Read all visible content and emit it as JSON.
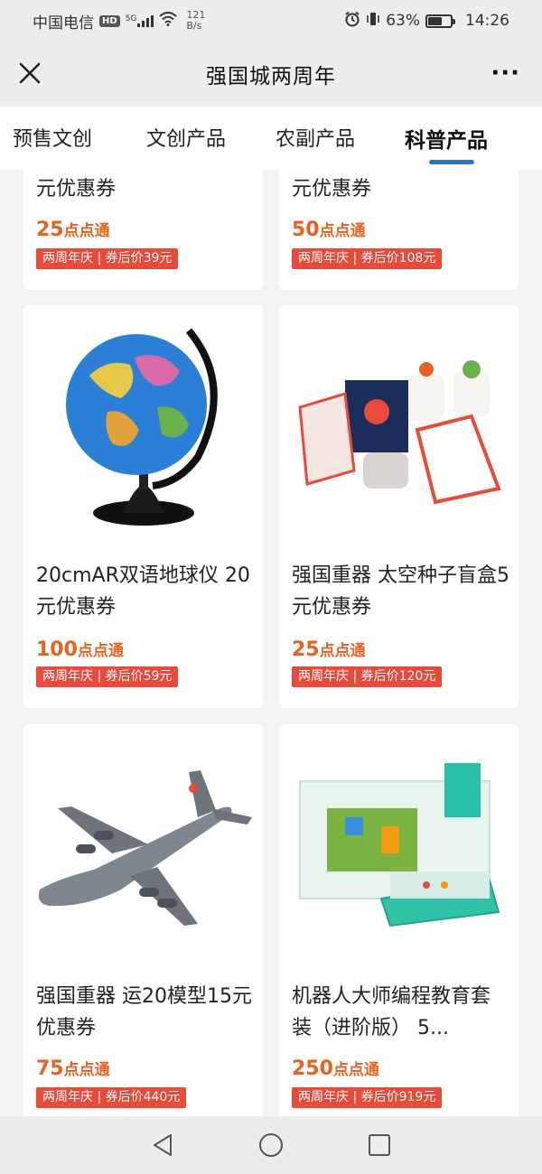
{
  "status": {
    "carrier": "中国电信",
    "hd": "HD",
    "net_type": "5G",
    "net_speed_value": "121",
    "net_speed_unit": "B/s",
    "battery": "63%",
    "battery_level": 0.63,
    "time": "14:26"
  },
  "nav": {
    "title": "强国城两周年",
    "more": "···"
  },
  "tabs": [
    {
      "label": "预售文创"
    },
    {
      "label": "文创产品"
    },
    {
      "label": "农副产品"
    },
    {
      "label": "科普产品",
      "active": true
    }
  ],
  "products": [
    {
      "title": "元优惠券",
      "points_num": "25",
      "points_unit": "点点通",
      "badge": "两周年庆 | 券后价39元"
    },
    {
      "title": "元优惠券",
      "points_num": "50",
      "points_unit": "点点通",
      "badge": "两周年庆 | 券后价108元"
    },
    {
      "title": "20cmAR双语地球仪 20元优惠券",
      "points_num": "100",
      "points_unit": "点点通",
      "badge": "两周年庆 | 券后价59元",
      "image": "globe-image"
    },
    {
      "title": "强国重器 太空种子盲盒5元优惠券",
      "points_num": "25",
      "points_unit": "点点通",
      "badge": "两周年庆 | 券后价120元",
      "image": "seed-box-image"
    },
    {
      "title": "强国重器 运20模型15元优惠券",
      "points_num": "75",
      "points_unit": "点点通",
      "badge": "两周年庆 | 券后价440元",
      "image": "airplane-image"
    },
    {
      "title": "机器人大师编程教育套装（进阶版） 5...",
      "points_num": "250",
      "points_unit": "点点通",
      "badge": "两周年庆 | 券后价919元",
      "image": "robot-kit-image"
    }
  ],
  "colors": {
    "accent": "#2a73c9",
    "points": "#e9611f",
    "badge": "#e94a3a"
  }
}
